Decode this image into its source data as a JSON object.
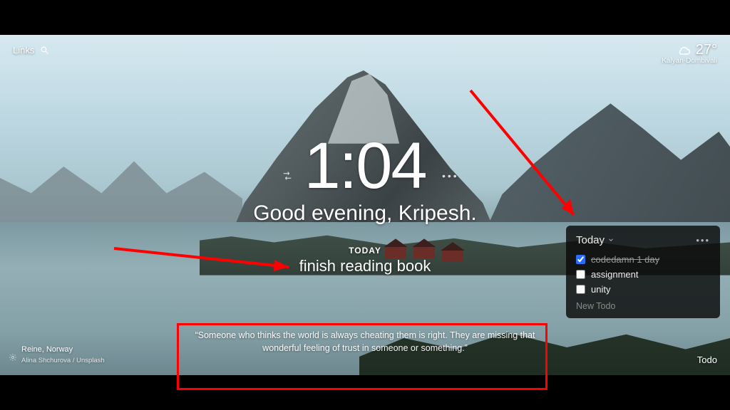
{
  "top": {
    "links_label": "Links",
    "weather": {
      "temp": "27°",
      "location": "Kalyan-Dombivali"
    }
  },
  "center": {
    "time": "1:04",
    "greeting": "Good evening, Kripesh.",
    "today_label": "TODAY",
    "focus_task": "finish reading book"
  },
  "quote": "“Someone who thinks the world is always cheating them is right. They are missing that wonderful feeling of trust in someone or something.”",
  "photo": {
    "location": "Reine, Norway",
    "credit": "Alina Shchurova / Unsplash"
  },
  "bottom_right": {
    "todo_label": "Todo"
  },
  "todo_popover": {
    "title": "Today",
    "items": [
      {
        "label": "codedamn 1 day",
        "done": true
      },
      {
        "label": "assignment",
        "done": false
      },
      {
        "label": "unity",
        "done": false
      }
    ],
    "new_placeholder": "New Todo"
  },
  "flanker_right": "•••",
  "colors": {
    "annotation": "#ff0000"
  }
}
